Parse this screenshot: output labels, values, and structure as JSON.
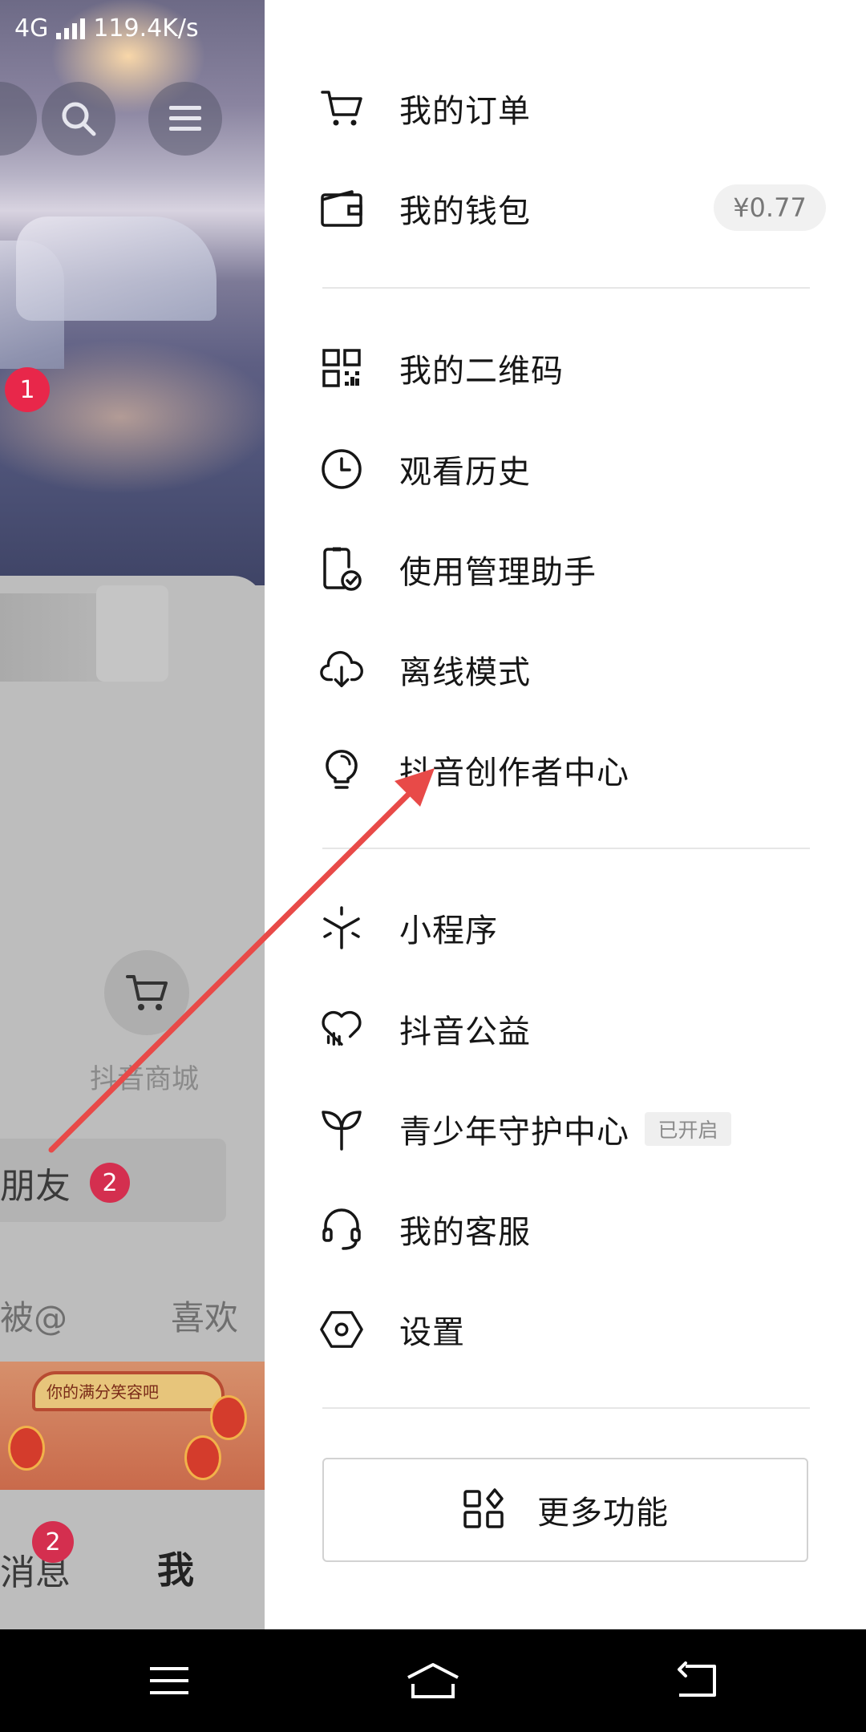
{
  "status_bar": {
    "network": "4G",
    "speed": "119.4K/s"
  },
  "profile_background": {
    "notification_badge": "1",
    "shop_label": "抖音商城",
    "friends_label": "朋友",
    "friends_badge": "2",
    "tabs": {
      "mentions": "被@",
      "likes": "喜欢"
    },
    "banner_text": "你的满分笑容吧",
    "bottom_tabs": {
      "messages": "消息",
      "messages_badge": "2",
      "me": "我"
    }
  },
  "drawer": {
    "orders": {
      "label": "我的订单",
      "icon": "cart-icon"
    },
    "wallet": {
      "label": "我的钱包",
      "icon": "wallet-icon",
      "balance": "¥0.77"
    },
    "qrcode": {
      "label": "我的二维码",
      "icon": "qr-code-icon"
    },
    "history": {
      "label": "观看历史",
      "icon": "clock-icon"
    },
    "assistant": {
      "label": "使用管理助手",
      "icon": "phone-check-icon"
    },
    "offline": {
      "label": "离线模式",
      "icon": "cloud-download-icon"
    },
    "creator": {
      "label": "抖音创作者中心",
      "icon": "lightbulb-icon"
    },
    "miniapps": {
      "label": "小程序",
      "icon": "asterisk-icon"
    },
    "charity": {
      "label": "抖音公益",
      "icon": "heart-icon"
    },
    "teen": {
      "label": "青少年守护中心",
      "icon": "sprout-icon",
      "status": "已开启"
    },
    "service": {
      "label": "我的客服",
      "icon": "headset-icon"
    },
    "settings": {
      "label": "设置",
      "icon": "hexagon-settings-icon"
    },
    "more": {
      "label": "更多功能",
      "icon": "grid-icon"
    }
  },
  "colors": {
    "badge_red": "#e8274a",
    "annotation_arrow": "#e84a48",
    "text_primary": "#161616"
  }
}
